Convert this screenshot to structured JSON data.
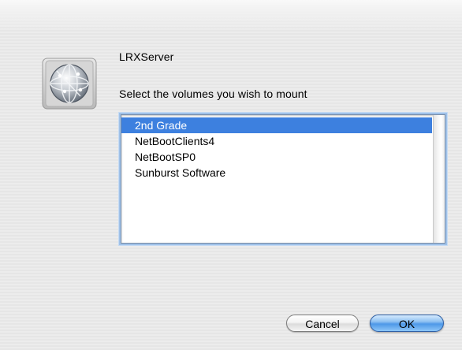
{
  "dialog": {
    "server_name": "LRXServer",
    "prompt": "Select the volumes you wish to mount",
    "icon": "network-globe-icon"
  },
  "volumes": {
    "selected_index": 0,
    "items": [
      {
        "label": "2nd Grade"
      },
      {
        "label": "NetBootClients4"
      },
      {
        "label": "NetBootSP0"
      },
      {
        "label": "Sunburst Software"
      }
    ]
  },
  "buttons": {
    "cancel_label": "Cancel",
    "ok_label": "OK"
  },
  "colors": {
    "selection": "#3d80df",
    "default_button": "#4e98e8"
  }
}
